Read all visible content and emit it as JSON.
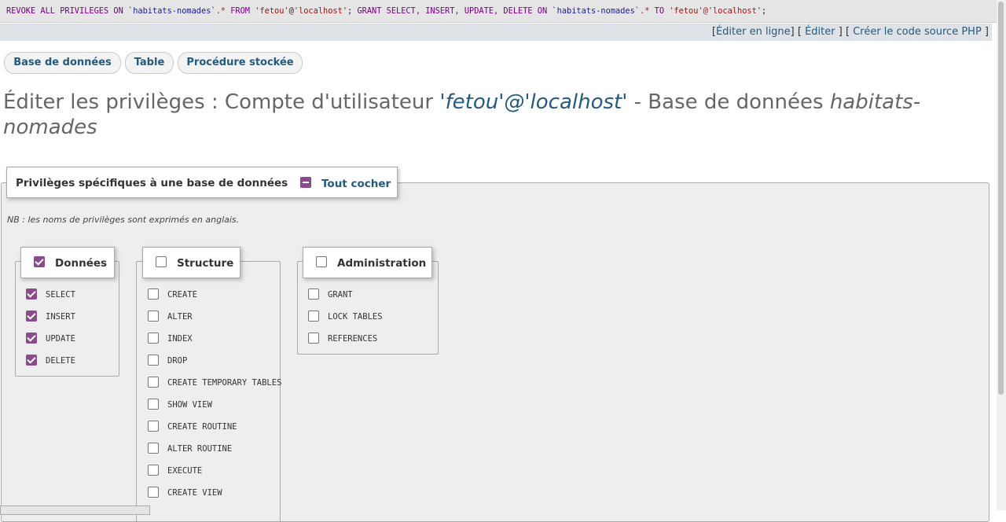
{
  "sql": {
    "revoke_kw": "REVOKE ALL PRIVILEGES ON",
    "db_ref1": "`habitats-nomades`",
    "dot_star1": ".*",
    "from_kw": "FROM",
    "user1_name": "'fetou'",
    "user1_at": "@",
    "user1_host": "'localhost'",
    "sep": ";",
    "grant_kw": "GRANT SELECT, INSERT, UPDATE, DELETE ON",
    "db_ref2": "`habitats-nomades`",
    "dot_star2": ".*",
    "to_kw": "TO",
    "user2": "'fetou'@'localhost'",
    "end": ";"
  },
  "links": {
    "open1": "[",
    "edit_inline": "Éditer en ligne",
    "mid1": "] [",
    "edit": "Éditer",
    "mid2": "] [",
    "create_php": "Créer le code source PHP",
    "close": "]"
  },
  "tabs": [
    "Base de données",
    "Table",
    "Procédure stockée"
  ],
  "title": {
    "prefix": "Éditer les privilèges : Compte d'utilisateur",
    "user": "'fetou'@'localhost'",
    "middle": "- Base de données",
    "db": "habitats-nomades"
  },
  "main_legend": {
    "title": "Privilèges spécifiques à une base de données",
    "check_all": "Tout cocher"
  },
  "note": "NB : les noms de privilèges sont exprimés en anglais.",
  "groups": {
    "data": {
      "label": "Données",
      "checked": true,
      "items": [
        {
          "label": "SELECT",
          "checked": true
        },
        {
          "label": "INSERT",
          "checked": true
        },
        {
          "label": "UPDATE",
          "checked": true
        },
        {
          "label": "DELETE",
          "checked": true
        }
      ]
    },
    "structure": {
      "label": "Structure",
      "checked": false,
      "items": [
        {
          "label": "CREATE",
          "checked": false
        },
        {
          "label": "ALTER",
          "checked": false
        },
        {
          "label": "INDEX",
          "checked": false
        },
        {
          "label": "DROP",
          "checked": false
        },
        {
          "label": "CREATE TEMPORARY TABLES",
          "checked": false
        },
        {
          "label": "SHOW VIEW",
          "checked": false
        },
        {
          "label": "CREATE ROUTINE",
          "checked": false
        },
        {
          "label": "ALTER ROUTINE",
          "checked": false
        },
        {
          "label": "EXECUTE",
          "checked": false
        },
        {
          "label": "CREATE VIEW",
          "checked": false
        }
      ]
    },
    "admin": {
      "label": "Administration",
      "checked": false,
      "items": [
        {
          "label": "GRANT",
          "checked": false
        },
        {
          "label": "LOCK TABLES",
          "checked": false
        },
        {
          "label": "REFERENCES",
          "checked": false
        }
      ]
    }
  },
  "colors": {
    "accent": "#8a4a8b",
    "link": "#235a81"
  }
}
